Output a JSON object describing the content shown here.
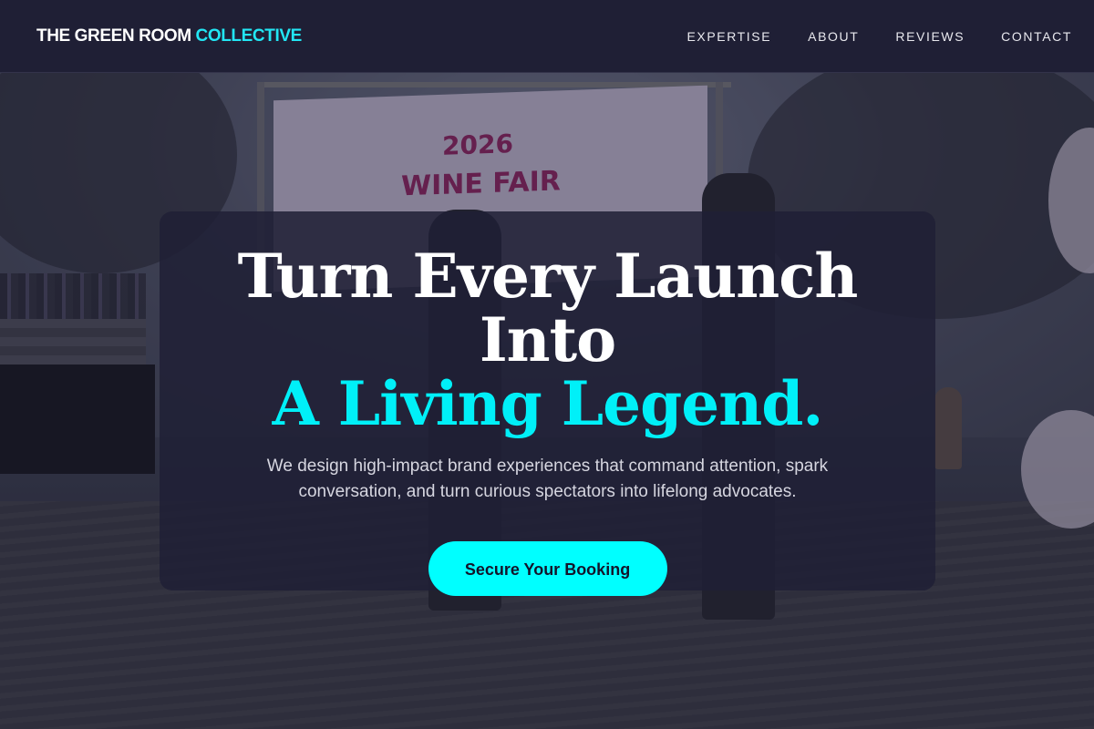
{
  "brand": {
    "part1": "THE GREEN ROOM",
    "part2": "COLLECTIVE"
  },
  "nav": {
    "items": [
      "EXPERTISE",
      "ABOUT",
      "REVIEWS",
      "CONTACT"
    ]
  },
  "hero": {
    "background_banner": {
      "line1": "2026",
      "line2": "WINE FAIR"
    },
    "headline_line1": "Turn Every Launch Into",
    "headline_line2": "A Living Legend.",
    "lead": "We design high-impact brand experiences that command attention, spark conversation, and turn curious spectators into lifelong advocates.",
    "cta_label": "Secure Your Booking"
  },
  "colors": {
    "accent": "#00f0f8",
    "header_bg": "#1f1f35",
    "cta_bg": "#00ffff"
  }
}
